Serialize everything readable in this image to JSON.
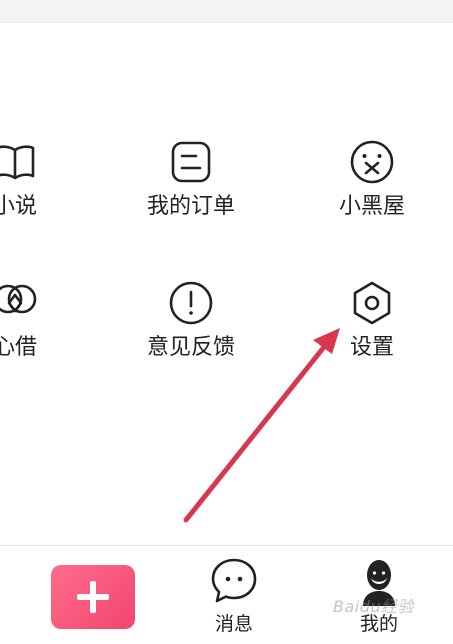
{
  "menu": {
    "row1": [
      {
        "label": "小说",
        "icon": "book-icon"
      },
      {
        "label": "我的订单",
        "icon": "order-icon"
      },
      {
        "label": "小黑屋",
        "icon": "dizzy-face-icon"
      }
    ],
    "row2": [
      {
        "label": "心借",
        "icon": "loan-diamond-icon"
      },
      {
        "label": "意见反馈",
        "icon": "exclamation-circle-icon"
      },
      {
        "label": "设置",
        "icon": "hexagon-settings-icon"
      }
    ]
  },
  "bottom_nav": {
    "publish_icon": "plus-icon",
    "messages_label": "消息",
    "mine_label": "我的"
  },
  "watermark": "Baidu经验",
  "colors": {
    "accent": "#f2456f",
    "annotation_arrow": "#d9364f",
    "icon_stroke": "#222222"
  }
}
